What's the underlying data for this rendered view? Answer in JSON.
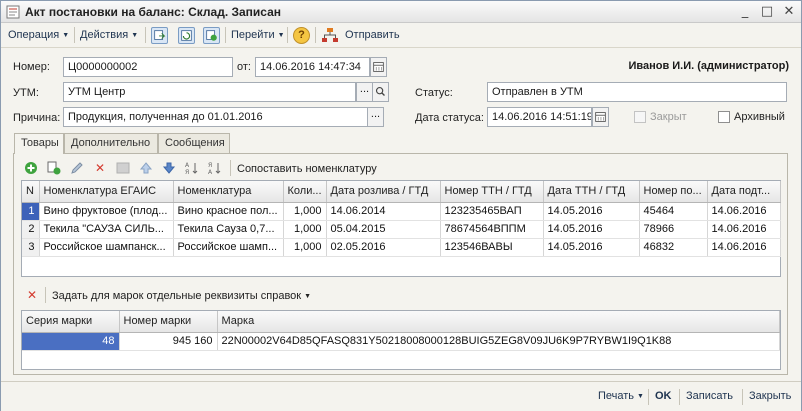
{
  "window": {
    "title": "Акт постановки на баланс: Склад. Записан",
    "controls": {
      "minimize": "_",
      "maximize": "□",
      "close": "✕"
    }
  },
  "toolbar": {
    "operation": "Операция",
    "actions": "Действия",
    "goto": "Перейти",
    "help": "?",
    "send": "Отправить"
  },
  "form": {
    "number_label": "Номер:",
    "number_value": "Ц0000000002",
    "from_label": "от:",
    "date_value": "14.06.2016 14:47:34",
    "user": "Иванов И.И. (администратор)",
    "utm_label": "УТМ:",
    "utm_value": "УТМ Центр",
    "status_label": "Статус:",
    "status_value": "Отправлен в УТМ",
    "reason_label": "Причина:",
    "reason_value": "Продукция, полученная до 01.01.2016",
    "status_date_label": "Дата статуса:",
    "status_date_value": "14.06.2016 14:51:19",
    "closed_label": "Закрыт",
    "archived_label": "Архивный"
  },
  "tabs": [
    "Товары",
    "Дополнительно",
    "Сообщения"
  ],
  "goods": {
    "match_button": "Сопоставить номенклатуру",
    "columns": [
      "N",
      "Номенклатура ЕГАИС",
      "Номенклатура",
      "Коли...",
      "Дата розлива / ГТД",
      "Номер ТТН / ГТД",
      "Дата ТТН / ГТД",
      "Номер по...",
      "Дата подт..."
    ],
    "rows": [
      [
        "1",
        "Вино фруктовое (плод...",
        "Вино красное пол...",
        "1,000",
        "14.06.2014",
        "123235465ВАП",
        "14.05.2016",
        "45464",
        "14.06.2016"
      ],
      [
        "2",
        "Текила \"САУЗА СИЛЬ...",
        "Текила Сауза 0,7...",
        "1,000",
        "05.04.2015",
        "78674564ВППМ",
        "14.05.2016",
        "78966",
        "14.06.2016"
      ],
      [
        "3",
        "Российское шампанск...",
        "Российское шамп...",
        "1,000",
        "02.05.2016",
        "123546ВАВЫ",
        "14.05.2016",
        "46832",
        "14.06.2016"
      ]
    ]
  },
  "marks": {
    "set_details_button": "Задать для марок отдельные реквизиты справок",
    "columns": [
      "Серия марки",
      "Номер марки",
      "Марка"
    ],
    "rows": [
      [
        "48",
        "945 160",
        "22N00002V64D85QFASQ831Y50218008000128BUIG5ZEG8V09JU6K9P7RYBW1I9Q1K88"
      ]
    ]
  },
  "footer": {
    "print": "Печать",
    "ok": "OK",
    "save": "Записать",
    "close": "Закрыть"
  }
}
